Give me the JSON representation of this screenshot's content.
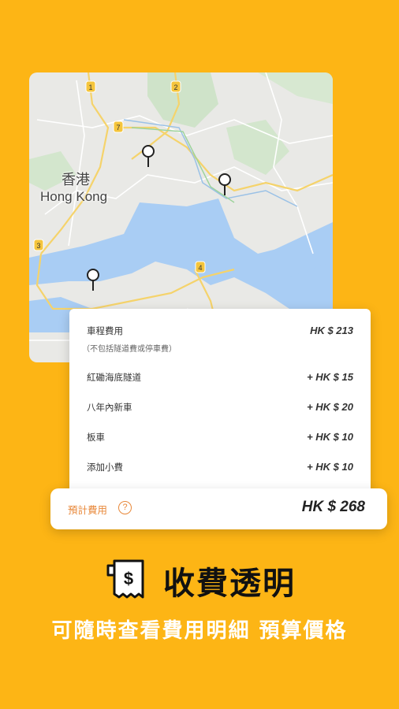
{
  "map": {
    "city_zh": "香港",
    "city_en": "Hong Kong",
    "route_badges": [
      "1",
      "2",
      "7",
      "3",
      "4"
    ]
  },
  "fee_card": {
    "base_label": "車程費用",
    "base_note": "（不包括隧道費或停車費）",
    "base_amount": "HK $ 213",
    "items": [
      {
        "label": "紅磡海底隧道",
        "amount": "+ HK $ 15"
      },
      {
        "label": "八年內新車",
        "amount": "+ HK $ 20"
      },
      {
        "label": "板車",
        "amount": "+ HK $ 10"
      },
      {
        "label": "添加小費",
        "amount": "+ HK $ 10"
      }
    ]
  },
  "total": {
    "label": "預計費用",
    "help_glyph": "?",
    "amount": "HK $ 268"
  },
  "headline": "收費透明",
  "subline": "可隨時查看費用明細 預算價格",
  "colors": {
    "background": "#FDB515",
    "accent": "#E8883A"
  }
}
